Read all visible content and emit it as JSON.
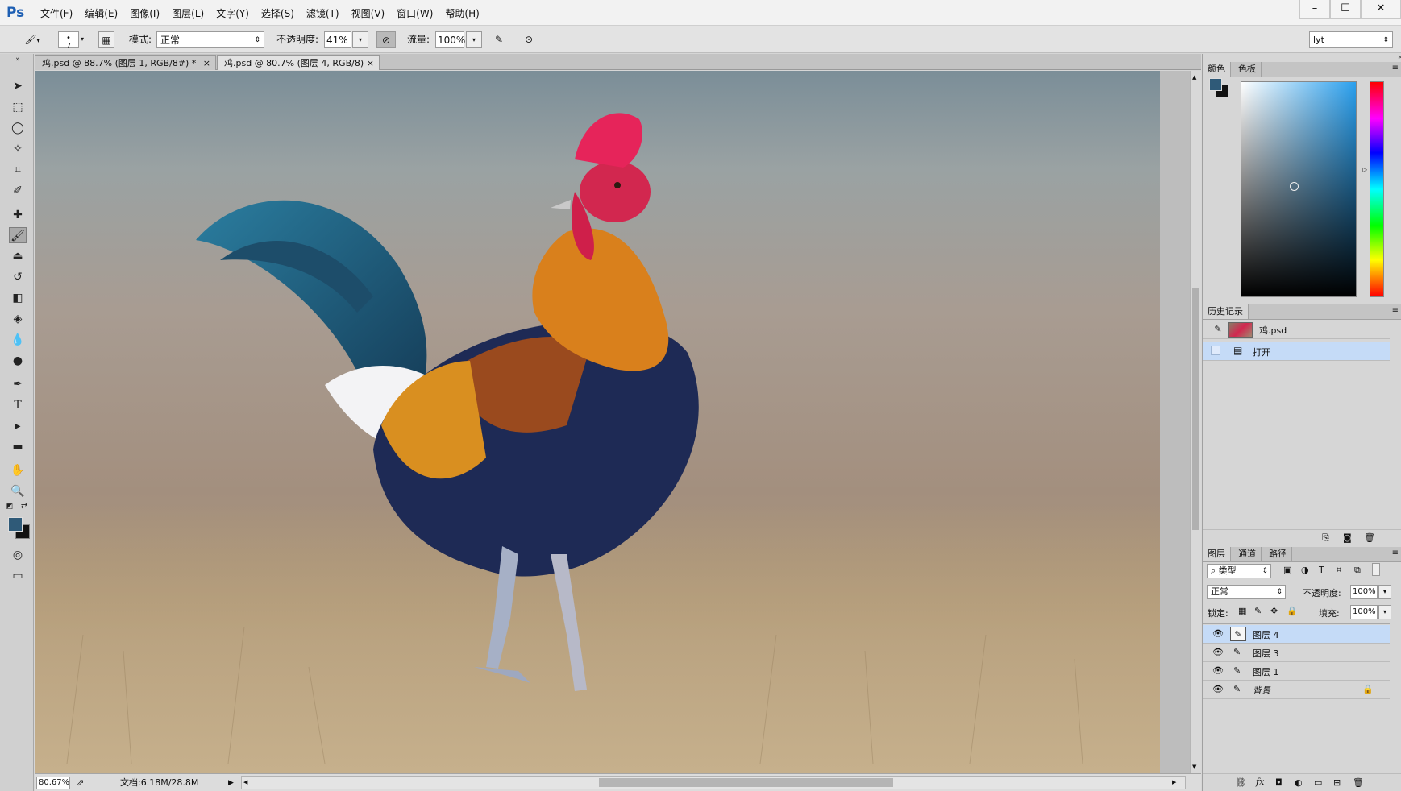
{
  "app": {
    "logo": "Ps"
  },
  "menu": [
    "文件(F)",
    "编辑(E)",
    "图像(I)",
    "图层(L)",
    "文字(Y)",
    "选择(S)",
    "滤镜(T)",
    "视图(V)",
    "窗口(W)",
    "帮助(H)"
  ],
  "window_controls": {
    "minimize": "–",
    "maximize": "☐",
    "close": "✕"
  },
  "options": {
    "brush_size": "7",
    "mode_label": "模式:",
    "mode_value": "正常",
    "opacity_label": "不透明度:",
    "opacity_value": "41%",
    "flow_label": "流量:",
    "flow_value": "100%",
    "workspace": "lyt"
  },
  "tabs": [
    {
      "label": "鸡.psd @ 88.7% (图层 1, RGB/8#) *",
      "close": "×"
    },
    {
      "label": "鸡.psd @ 80.7% (图层 4, RGB/8)",
      "close": "×"
    }
  ],
  "status": {
    "zoom": "80.67%",
    "doc": "文档:6.18M/28.8M"
  },
  "color_panel": {
    "tabs": [
      "颜色",
      "色板"
    ],
    "foreground": "#2f5a78",
    "background": "#111111"
  },
  "history_panel": {
    "title": "历史记录",
    "snapshot": "鸡.psd",
    "items": [
      "打开"
    ]
  },
  "layers_panel": {
    "tabs": [
      "图层",
      "通道",
      "路径"
    ],
    "filter_label": "类型",
    "blend_mode": "正常",
    "opacity_label": "不透明度:",
    "opacity_value": "100%",
    "lock_label": "锁定:",
    "fill_label": "填充:",
    "fill_value": "100%",
    "layers": [
      {
        "name": "图层 4",
        "selected": true
      },
      {
        "name": "图层 3",
        "selected": false
      },
      {
        "name": "图层 1",
        "selected": false
      },
      {
        "name": "背景",
        "selected": false,
        "locked": true
      }
    ]
  }
}
